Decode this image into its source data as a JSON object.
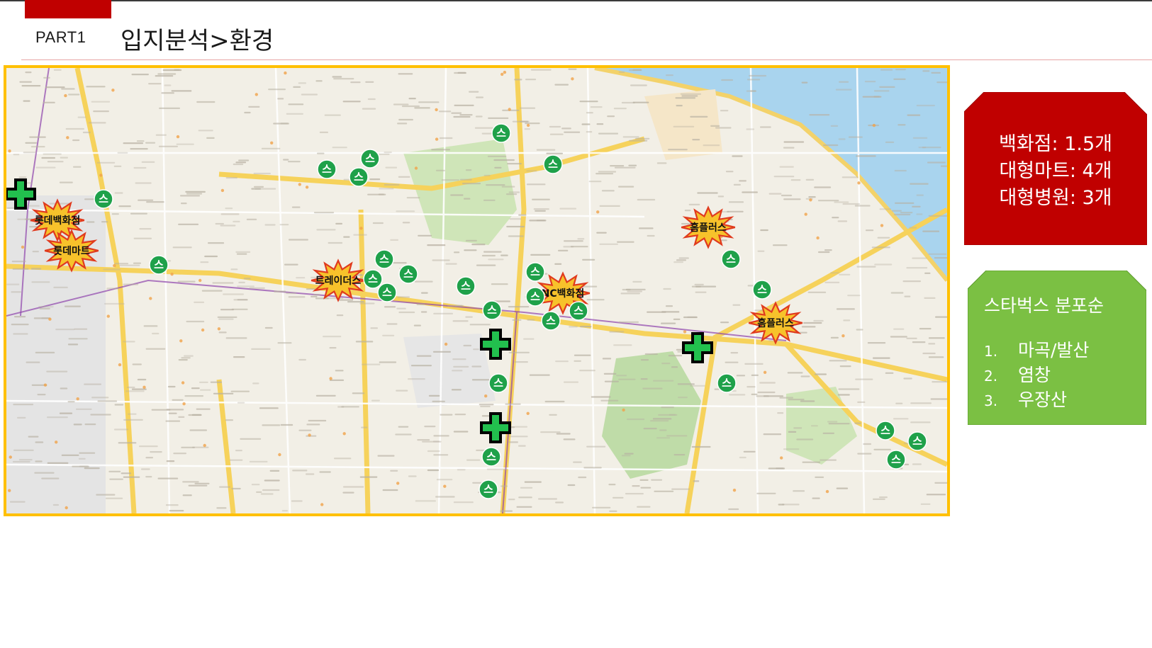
{
  "header": {
    "part_label": "PART1",
    "title": "입지분석>환경"
  },
  "map": {
    "department_stores": [
      {
        "label": "롯데백화점"
      },
      {
        "label": "NC백화점"
      }
    ],
    "marts": [
      {
        "label": "롯데마트"
      },
      {
        "label": "트레이더스"
      },
      {
        "label": "홈플러스"
      },
      {
        "label": "홈플러스"
      }
    ],
    "starbucks_marker": {
      "glyph": "스",
      "color": "#1fa14a"
    },
    "hospital_marker": {
      "color": "#22c04e",
      "outline": "#000000"
    }
  },
  "summary": {
    "lines": [
      "백화점: 1.5개",
      "대형마트: 4개",
      "대형병원: 3개"
    ],
    "color": "#c00000"
  },
  "starbucks_rank": {
    "title": "스타벅스 분포순",
    "items": [
      {
        "num": "1.",
        "text": "마곡/발산"
      },
      {
        "num": "2.",
        "text": "염창"
      },
      {
        "num": "3.",
        "text": "우장산"
      }
    ],
    "color": "#7bc043"
  }
}
